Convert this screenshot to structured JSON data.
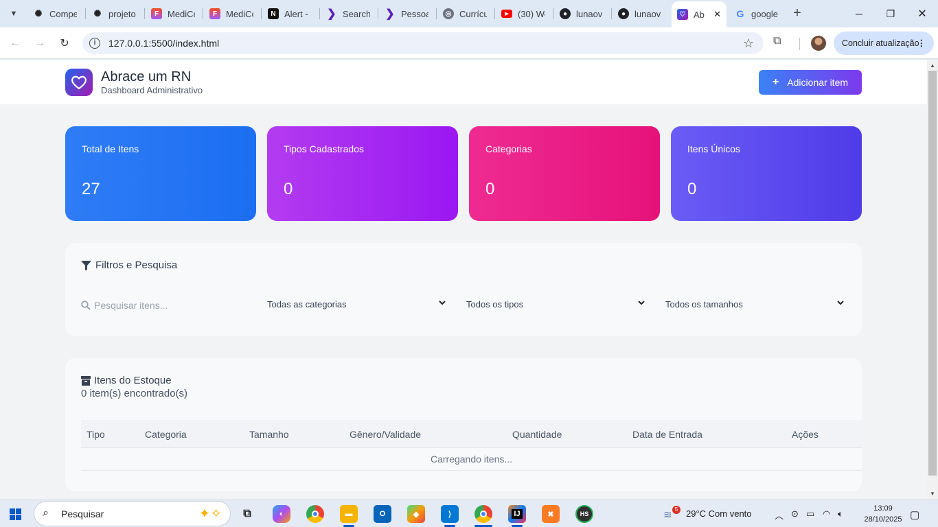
{
  "browser": {
    "tabs": [
      {
        "label": "Compe",
        "icon": "openai-icon"
      },
      {
        "label": "projeto",
        "icon": "openai-icon"
      },
      {
        "label": "MediCo",
        "icon": "figma-icon"
      },
      {
        "label": "MediCo",
        "icon": "figma-icon"
      },
      {
        "label": "Alert -",
        "icon": "notion-icon"
      },
      {
        "label": "Search",
        "icon": "arrow-icon"
      },
      {
        "label": "Pessoa",
        "icon": "arrow-icon"
      },
      {
        "label": "Currícu",
        "icon": "globe-icon"
      },
      {
        "label": "(30) We",
        "icon": "youtube-icon"
      },
      {
        "label": "lunaov",
        "icon": "github-icon"
      },
      {
        "label": "lunaov",
        "icon": "github-icon"
      },
      {
        "label": "Ab",
        "icon": "heart-icon",
        "active": true
      },
      {
        "label": "google",
        "icon": "google-icon"
      }
    ],
    "url": "127.0.0.1:5500/index.html",
    "update_label": "Concluir atualização"
  },
  "app": {
    "title": "Abrace um RN",
    "subtitle": "Dashboard Administrativo",
    "add_button": "Adicionar item",
    "accent": "#3b82f6"
  },
  "stats": [
    {
      "label": "Total de Itens",
      "value": "27"
    },
    {
      "label": "Tipos Cadastrados",
      "value": "0"
    },
    {
      "label": "Categorias",
      "value": "0"
    },
    {
      "label": "Itens Únicos",
      "value": "0"
    }
  ],
  "filters": {
    "title": "Filtros e Pesquisa",
    "search_placeholder": "Pesquisar itens...",
    "category": "Todas as categorias",
    "type": "Todos os tipos",
    "size": "Todos os tamanhos"
  },
  "stock": {
    "title": "Itens do Estoque",
    "count": "0 item(s) encontrado(s)",
    "columns": [
      "Tipo",
      "Categoria",
      "Tamanho",
      "Gênero/Validade",
      "Quantidade",
      "Data de Entrada",
      "Ações"
    ],
    "loading": "Carregando itens..."
  },
  "taskbar": {
    "search": "Pesquisar",
    "weather_badge": "5",
    "weather": "29°C  Com vento",
    "time": "13:09",
    "date": "28/10/2025"
  }
}
